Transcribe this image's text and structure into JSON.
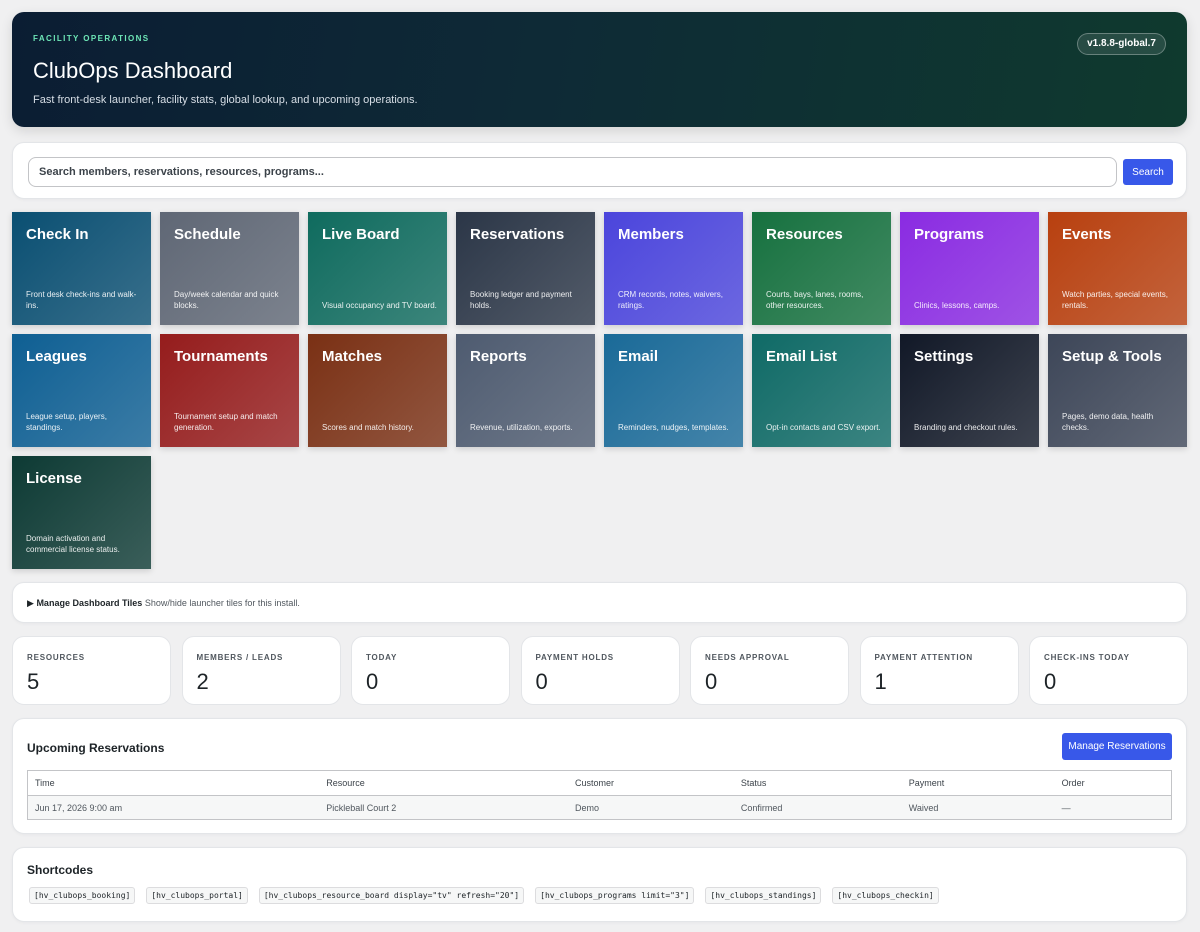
{
  "header": {
    "eyebrow": "FACILITY OPERATIONS",
    "title": "ClubOps Dashboard",
    "subtitle": "Fast front-desk launcher, facility stats, global lookup, and upcoming operations.",
    "version": "v1.8.8-global.7"
  },
  "search": {
    "placeholder": "Search members, reservations, resources, programs...",
    "button": "Search"
  },
  "tiles": [
    {
      "title": "Check In",
      "desc": "Front desk check-ins and walk-ins.",
      "color": "#0a4f72"
    },
    {
      "title": "Schedule",
      "desc": "Day/week calendar and quick blocks.",
      "color": "#5f6775"
    },
    {
      "title": "Live Board",
      "desc": "Visual occupancy and TV board.",
      "color": "#0f6b5e"
    },
    {
      "title": "Reservations",
      "desc": "Booking ledger and payment holds.",
      "color": "#2b3647"
    },
    {
      "title": "Members",
      "desc": "CRM records, notes, waivers, ratings.",
      "color": "#4b45dc"
    },
    {
      "title": "Resources",
      "desc": "Courts, bays, lanes, rooms, other resources.",
      "color": "#16713f"
    },
    {
      "title": "Programs",
      "desc": "Clinics, lessons, camps.",
      "color": "#8a2be2"
    },
    {
      "title": "Events",
      "desc": "Watch parties, special events, rentals.",
      "color": "#b8400f"
    },
    {
      "title": "Leagues",
      "desc": "League setup, players, standings.",
      "color": "#0e5f93"
    },
    {
      "title": "Tournaments",
      "desc": "Tournament setup and match generation.",
      "color": "#951c1c"
    },
    {
      "title": "Matches",
      "desc": "Scores and match history.",
      "color": "#7a3014"
    },
    {
      "title": "Reports",
      "desc": "Revenue, utilization, exports.",
      "color": "#4e5b70"
    },
    {
      "title": "Email",
      "desc": "Reminders, nudges, templates.",
      "color": "#1a6a98"
    },
    {
      "title": "Email List",
      "desc": "Opt-in contacts and CSV export.",
      "color": "#0f6a66"
    },
    {
      "title": "Settings",
      "desc": "Branding and checkout rules.",
      "color": "#111827"
    },
    {
      "title": "Setup & Tools",
      "desc": "Pages, demo data, health checks.",
      "color": "#3d4658"
    },
    {
      "title": "License",
      "desc": "Domain activation and commercial license status.",
      "color": "#0d3a34"
    }
  ],
  "manage_tiles": {
    "label": "Manage Dashboard Tiles",
    "hint": "Show/hide launcher tiles for this install."
  },
  "stats": [
    {
      "label": "RESOURCES",
      "value": "5"
    },
    {
      "label": "MEMBERS / LEADS",
      "value": "2"
    },
    {
      "label": "TODAY",
      "value": "0"
    },
    {
      "label": "PAYMENT HOLDS",
      "value": "0"
    },
    {
      "label": "NEEDS APPROVAL",
      "value": "0"
    },
    {
      "label": "PAYMENT ATTENTION",
      "value": "1"
    },
    {
      "label": "CHECK-INS TODAY",
      "value": "0"
    }
  ],
  "reservations": {
    "title": "Upcoming Reservations",
    "button": "Manage Reservations",
    "columns": [
      "Time",
      "Resource",
      "Customer",
      "Status",
      "Payment",
      "Order"
    ],
    "rows": [
      [
        "Jun 17, 2026 9:00 am",
        "Pickleball Court 2",
        "Demo",
        "Confirmed",
        "Waived",
        "—"
      ]
    ]
  },
  "shortcodes": {
    "title": "Shortcodes",
    "items": [
      "[hv_clubops_booking]",
      "[hv_clubops_portal]",
      "[hv_clubops_resource_board display=\"tv\" refresh=\"20\"]",
      "[hv_clubops_programs limit=\"3\"]",
      "[hv_clubops_standings]",
      "[hv_clubops_checkin]"
    ]
  }
}
